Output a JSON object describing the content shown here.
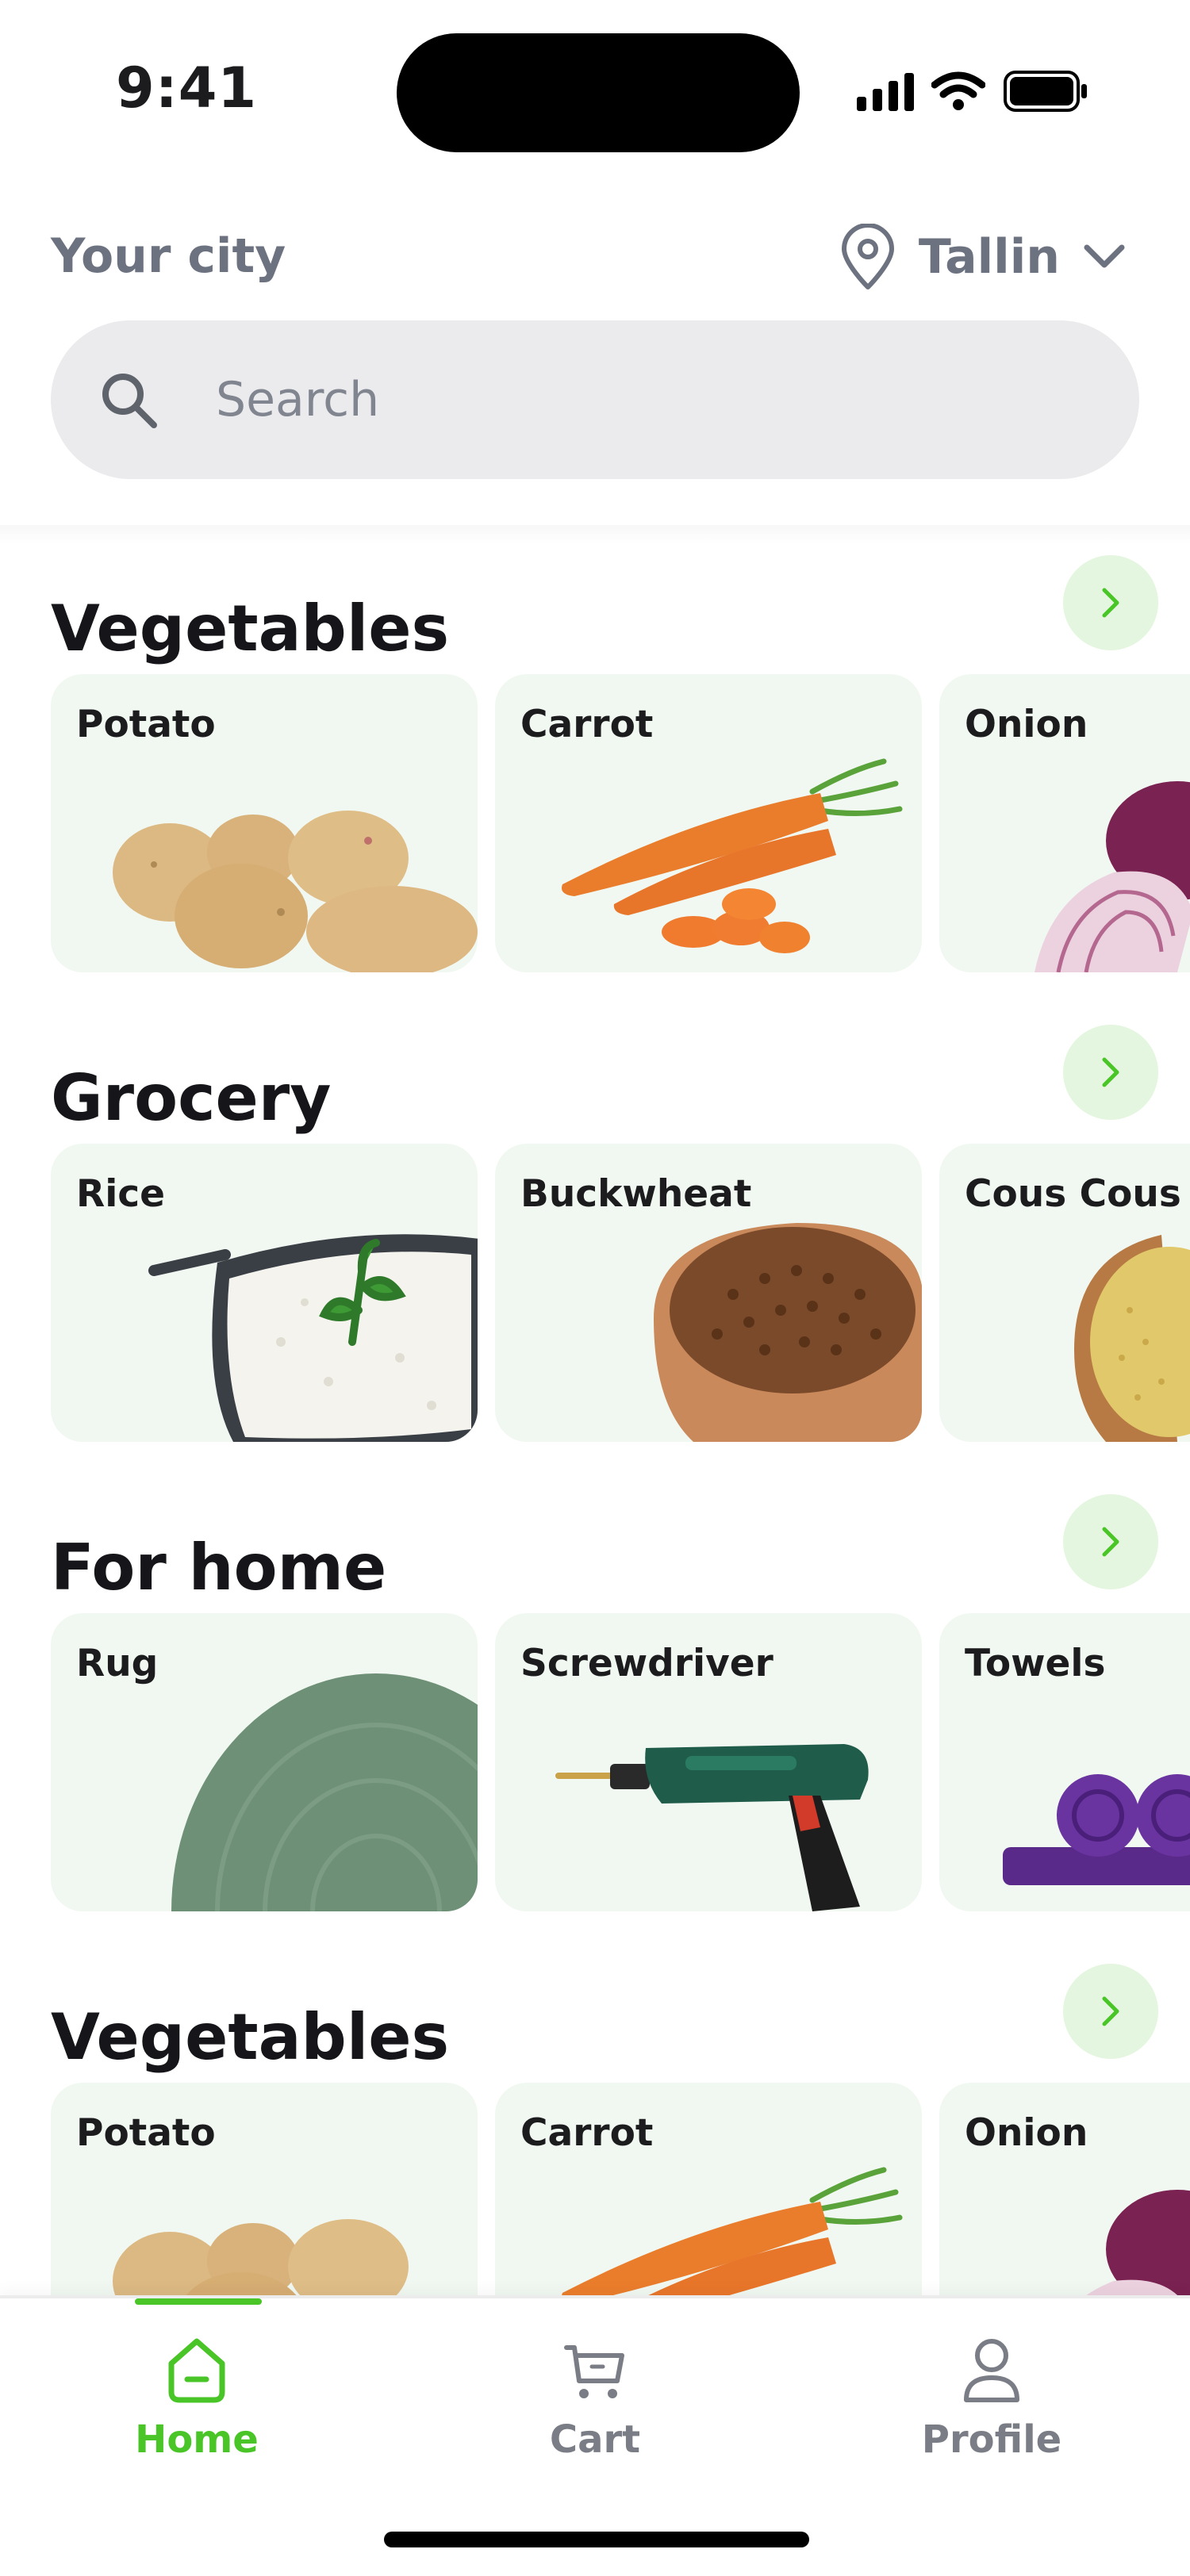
{
  "status_bar": {
    "time": "9:41"
  },
  "header": {
    "city_label": "Your city",
    "city_value": "Tallin",
    "search_placeholder": "Search"
  },
  "sections": [
    {
      "title": "Vegetables",
      "items": [
        {
          "label": "Potato",
          "icon": "potato"
        },
        {
          "label": "Carrot",
          "icon": "carrot"
        },
        {
          "label": "Onion",
          "icon": "onion"
        }
      ]
    },
    {
      "title": "Grocery",
      "items": [
        {
          "label": "Rice",
          "icon": "rice"
        },
        {
          "label": "Buckwheat",
          "icon": "buckwheat"
        },
        {
          "label": "Cous Cous",
          "icon": "couscous"
        }
      ]
    },
    {
      "title": "For home",
      "items": [
        {
          "label": "Rug",
          "icon": "rug"
        },
        {
          "label": "Screwdriver",
          "icon": "screwdriver"
        },
        {
          "label": "Towels",
          "icon": "towels"
        }
      ]
    },
    {
      "title": "Vegetables",
      "items": [
        {
          "label": "Potato",
          "icon": "potato"
        },
        {
          "label": "Carrot",
          "icon": "carrot"
        },
        {
          "label": "Onion",
          "icon": "onion"
        }
      ]
    }
  ],
  "tabbar": {
    "home": "Home",
    "cart": "Cart",
    "profile": "Profile",
    "active": "home",
    "accent_color": "#4ac527"
  }
}
